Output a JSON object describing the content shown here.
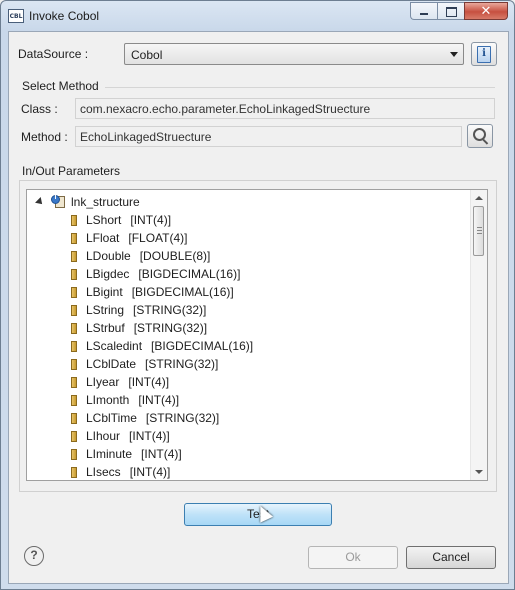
{
  "window": {
    "title": "Invoke Cobol",
    "app_icon_text": "CBL"
  },
  "datasource": {
    "label": "DataSource :",
    "value": "Cobol",
    "icon": "datasource-info-icon"
  },
  "select_method": {
    "group_title": "Select Method",
    "class_label": "Class :",
    "class_value": "com.nexacro.echo.parameter.EchoLinkagedStruecture",
    "method_label": "Method :",
    "method_value": "EchoLinkagedStruecture",
    "search_icon": "search-icon"
  },
  "params": {
    "group_title": "In/Out Parameters",
    "root": "lnk_structure",
    "fields": [
      {
        "name": "LShort",
        "type": "[INT(4)]"
      },
      {
        "name": "LFloat",
        "type": "[FLOAT(4)]"
      },
      {
        "name": "LDouble",
        "type": "[DOUBLE(8)]"
      },
      {
        "name": "LBigdec",
        "type": "[BIGDECIMAL(16)]"
      },
      {
        "name": "LBigint",
        "type": "[BIGDECIMAL(16)]"
      },
      {
        "name": "LString",
        "type": "[STRING(32)]"
      },
      {
        "name": "LStrbuf",
        "type": "[STRING(32)]"
      },
      {
        "name": "LScaledint",
        "type": "[BIGDECIMAL(16)]"
      },
      {
        "name": "LCblDate",
        "type": "[STRING(32)]"
      },
      {
        "name": "LIyear",
        "type": "[INT(4)]"
      },
      {
        "name": "LImonth",
        "type": "[INT(4)]"
      },
      {
        "name": "LCblTime",
        "type": "[STRING(32)]"
      },
      {
        "name": "LIhour",
        "type": "[INT(4)]"
      },
      {
        "name": "LIminute",
        "type": "[INT(4)]"
      },
      {
        "name": "LIsecs",
        "type": "[INT(4)]"
      }
    ]
  },
  "buttons": {
    "test": "Test",
    "ok": "Ok",
    "cancel": "Cancel",
    "help": "?"
  }
}
